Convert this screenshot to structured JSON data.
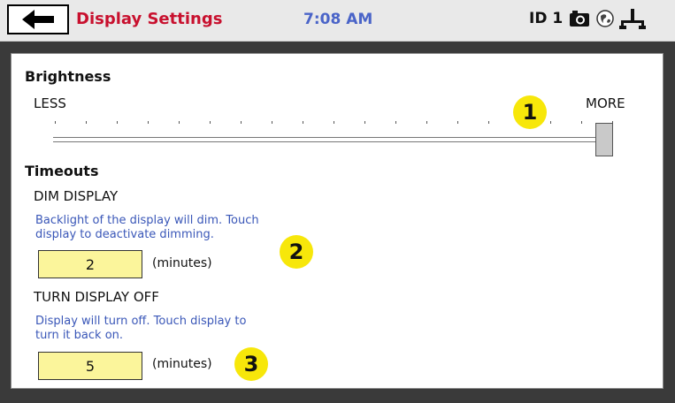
{
  "header": {
    "title": "Display Settings",
    "time": "7:08 AM",
    "id_label": "ID 1"
  },
  "brightness": {
    "heading": "Brightness",
    "min_label": "LESS",
    "max_label": "MORE",
    "level": 1.0
  },
  "timeouts": {
    "heading": "Timeouts",
    "dim": {
      "label": "DIM DISPLAY",
      "description_line1": "Backlight of the display will dim.  Touch",
      "description_line2": "display to deactivate dimming.",
      "value": "2",
      "unit": "(minutes)"
    },
    "off": {
      "label": "TURN DISPLAY OFF",
      "description_line1": "Display will turn off.  Touch display to",
      "description_line2": "turn it back on.",
      "value": "5",
      "unit": "(minutes)"
    }
  },
  "callouts": [
    "1",
    "2",
    "3"
  ]
}
